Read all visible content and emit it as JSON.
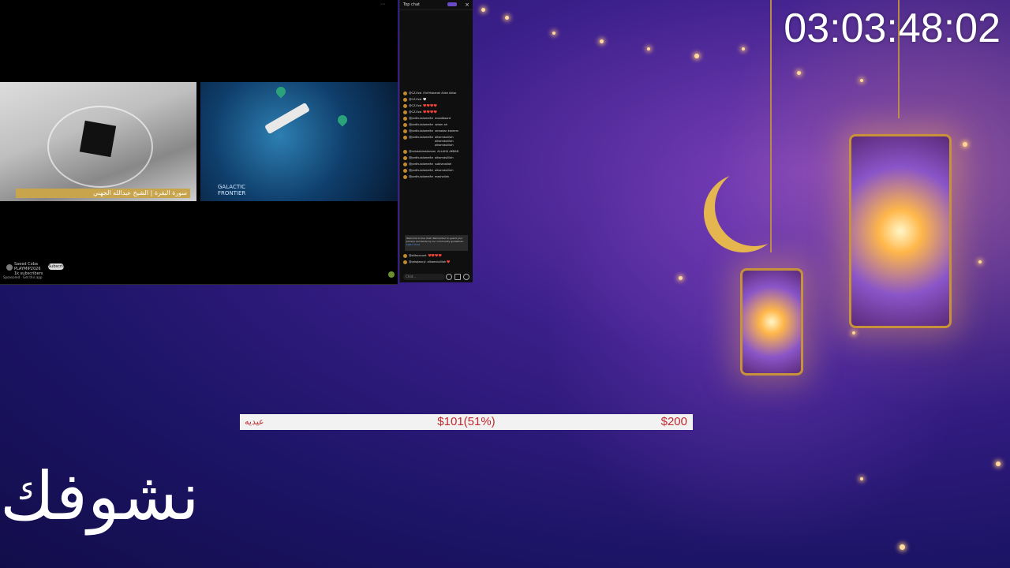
{
  "timer": "03:03:48:02",
  "goal": {
    "label": "عيديه",
    "progress": "$101(51%)",
    "target": "$200",
    "progress_fraction": 0.51
  },
  "overlay_text": "نشوفك",
  "player": {
    "video1_caption": "سورة البقرة  |  الشيخ عبدالله الجهني",
    "video2_title_line1": "GALACTIC",
    "video2_title_line2": "FRONTIER",
    "channel_name": "Saeed Coba",
    "channel_handle": "PLAYMIP2026",
    "channel_sub": "1k subscribers",
    "subscribe_label": "Subscribe",
    "sponsor_text": "Sponsored · Get this app"
  },
  "chat": {
    "header_title": "Top chat",
    "close_glyph": "×",
    "input_placeholder": "Chat...",
    "messages": [
      {
        "user": "@CZ-Ezsl",
        "text": "Eid Mubarak Allah Aktar"
      },
      {
        "user": "@CZ-Ezsl",
        "text": "🤍"
      },
      {
        "user": "@CZ-Ezsl",
        "text": "❤️❤️❤️❤️"
      },
      {
        "user": "@CZ-Ezsl",
        "text": "❤️❤️❤️❤️"
      },
      {
        "user": "@jordhulolomelte",
        "text": "moodboard"
      },
      {
        "user": "@jordhulolomelte",
        "text": "selam ah"
      },
      {
        "user": "@jordhulolomelte",
        "text": "ramadan kareem"
      },
      {
        "user": "@jordhulolomelte",
        "text": "alhamdulillah alhamdulillah alhamdulillah"
      },
      {
        "user": "@mindahmedorcon",
        "text": "ALLAHU AKBAR"
      },
      {
        "user": "@jordhulolomelte",
        "text": "alhamdulillah"
      },
      {
        "user": "@jordhulolomelte",
        "text": "subhanallah"
      },
      {
        "user": "@jordhulolomelte",
        "text": "alhamdulillah"
      },
      {
        "user": "@jordhulolomelte",
        "text": "mashallah"
      }
    ],
    "notice": "Welcome to live chat! Remember to guard your privacy and abide by our community guidelines.",
    "notice_link": "Learn more",
    "last_messages": [
      {
        "user": "@alilaccount",
        "text": "❤️❤️❤️❤️"
      },
      {
        "user": "@qrkajeacyl",
        "text": "alhamdulillah ❤️"
      }
    ]
  },
  "colors": {
    "goal_text": "#c0292e",
    "goal_bg": "#f2f2f2",
    "bg_purple": "#3b1f8a",
    "lantern_gold": "#c8923a"
  }
}
